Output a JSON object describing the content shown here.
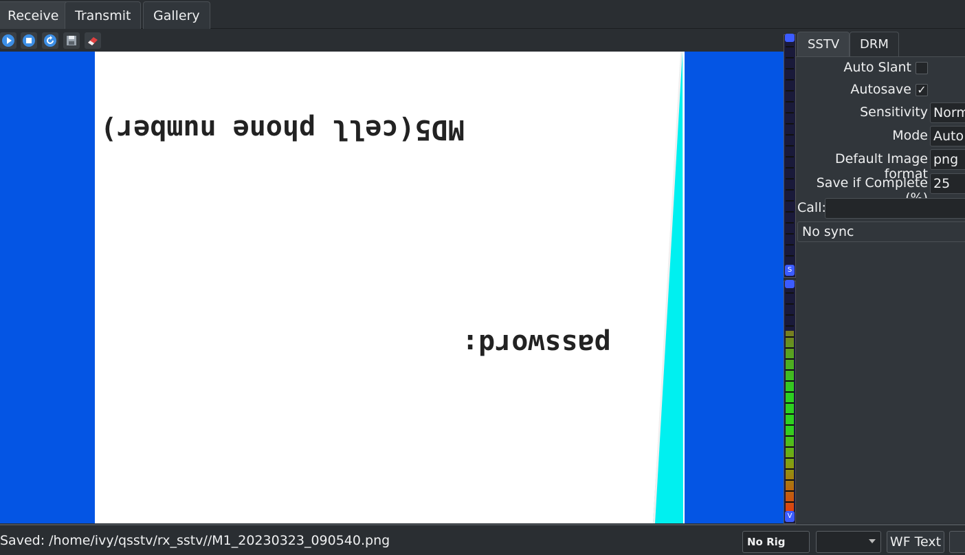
{
  "tabs": {
    "receive": "Receive",
    "transmit": "Transmit",
    "gallery": "Gallery"
  },
  "toolbar": {
    "icons": [
      "start-icon",
      "stop-icon",
      "refresh-icon",
      "save-icon",
      "erase-icon"
    ]
  },
  "image": {
    "line1": "MD5(cell phone number)",
    "line2": "password:"
  },
  "right_panel": {
    "tabs": {
      "sstv": "SSTV",
      "drm": "DRM"
    },
    "auto_slant_label": "Auto Slant",
    "autosave_label": "Autosave",
    "autosave_check": "✓",
    "sensitivity_label": "Sensitivity",
    "sensitivity_value": "Norm",
    "mode_label": "Mode",
    "mode_value": "Auto",
    "image_format_label": "Default Image format",
    "image_format_value": "png",
    "save_if_complete_label": "Save if Complete (%)",
    "save_if_complete_value": "25",
    "call_label": "Call:",
    "call_value": "",
    "sync_status": "No sync"
  },
  "meters": {
    "sync_meter_label": "S",
    "volume_meter_label": "V"
  },
  "statusbar": {
    "saved_text": "Saved: /home/ivy/qsstv/rx_sstv//M1_20230323_090540.png",
    "rig_text": "No Rig",
    "wf_text": "WF Text"
  },
  "colors": {
    "image_background": "#0455e4",
    "canvas": "#ffffff",
    "cyan_strip": "#00f0f0",
    "meter_knob": "#3c5cff"
  }
}
